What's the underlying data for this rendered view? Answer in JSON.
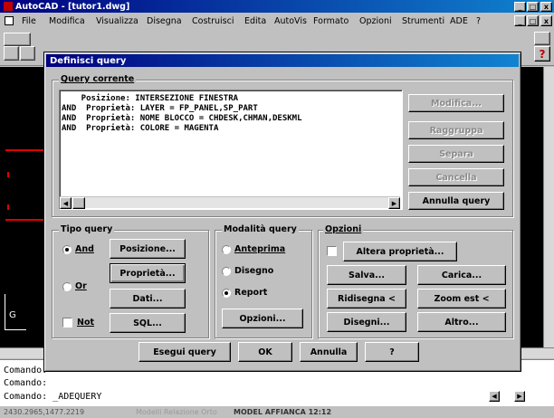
{
  "app": {
    "title": "AutoCAD - [tutor1.dwg]",
    "menu": [
      "File",
      "Modifica",
      "Visualizza",
      "Disegna",
      "Costruisci",
      "Edita",
      "AutoVis",
      "Formato",
      "Opzioni",
      "Strumenti",
      "ADE",
      "?"
    ],
    "window_controls": [
      "_",
      "□",
      "x"
    ],
    "help_button": "?"
  },
  "dialog": {
    "title": "Definisci query",
    "current_query": {
      "label": "Query corrente",
      "lines": [
        "    Posizione: INTERSEZIONE FINESTRA",
        "AND  Proprietà: LAYER = FP_PANEL,SP_PART",
        "AND  Proprietà: NOME BLOCCO = CHDESK,CHMAN,DESKML",
        "AND  Proprietà: COLORE = MAGENTA"
      ],
      "side_buttons": {
        "modify": "Modifica...",
        "group": "Raggruppa",
        "separate": "Separa",
        "delete": "Cancella",
        "undo": "Annulla query"
      }
    },
    "query_type": {
      "label": "Tipo query",
      "and_label": "And",
      "or_label": "Or",
      "not_label": "Not",
      "and_selected": true,
      "buttons": {
        "position": "Posizione...",
        "property": "Proprietà...",
        "data": "Dati...",
        "sql": "SQL..."
      }
    },
    "query_mode": {
      "label": "Modalità query",
      "preview": "Anteprima",
      "draw": "Disegno",
      "report": "Report",
      "selected": "Report",
      "options_button": "Opzioni..."
    },
    "options": {
      "label": "Opzioni",
      "alter_properties": "Altera proprietà...",
      "save": "Salva...",
      "load": "Carica...",
      "redraw": "Ridisegna <",
      "zoom": "Zoom est <",
      "draw": "Disegni...",
      "other": "Altro..."
    },
    "footer": {
      "execute": "Esegui query",
      "ok": "OK",
      "cancel": "Annulla",
      "help": "?"
    }
  },
  "command_line": {
    "lines": [
      "Comando:",
      "Comando:",
      "Comando:  _ADEQUERY"
    ]
  },
  "status_bar": {
    "coords": "2430.2965,1477.2219",
    "mode_text": "Modelli Relazione Orto",
    "model": "MODEL AFFIANCA 12:12"
  },
  "colors": {
    "desktop_gray": "#c0c0c0",
    "title_blue": "#000080",
    "drawing_bg": "#000000",
    "accent_red": "#e00000"
  }
}
